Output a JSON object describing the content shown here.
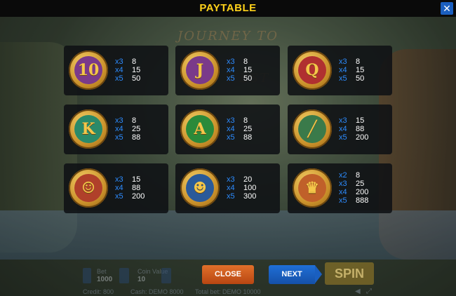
{
  "header": {
    "title": "PAYTABLE",
    "close_icon": "✕"
  },
  "background": {
    "logo_text": "JOURNEY TO THE WEST"
  },
  "symbols": [
    {
      "name": "10",
      "glyph": "10",
      "ring": "#7a3a8a",
      "pays": [
        {
          "m": "x3",
          "v": "8"
        },
        {
          "m": "x4",
          "v": "15"
        },
        {
          "m": "x5",
          "v": "50"
        }
      ]
    },
    {
      "name": "J",
      "glyph": "J",
      "ring": "#7a3a8a",
      "pays": [
        {
          "m": "x3",
          "v": "8"
        },
        {
          "m": "x4",
          "v": "15"
        },
        {
          "m": "x5",
          "v": "50"
        }
      ]
    },
    {
      "name": "Q",
      "glyph": "Q",
      "ring": "#b03030",
      "pays": [
        {
          "m": "x3",
          "v": "8"
        },
        {
          "m": "x4",
          "v": "15"
        },
        {
          "m": "x5",
          "v": "50"
        }
      ]
    },
    {
      "name": "K",
      "glyph": "K",
      "ring": "#2a8a6a",
      "pays": [
        {
          "m": "x3",
          "v": "8"
        },
        {
          "m": "x4",
          "v": "25"
        },
        {
          "m": "x5",
          "v": "88"
        }
      ]
    },
    {
      "name": "A",
      "glyph": "A",
      "ring": "#2a8a3a",
      "pays": [
        {
          "m": "x3",
          "v": "8"
        },
        {
          "m": "x4",
          "v": "25"
        },
        {
          "m": "x5",
          "v": "88"
        }
      ]
    },
    {
      "name": "staff",
      "glyph": "╱",
      "ring": "#3a7a4a",
      "pays": [
        {
          "m": "x3",
          "v": "15"
        },
        {
          "m": "x4",
          "v": "88"
        },
        {
          "m": "x5",
          "v": "200"
        }
      ]
    },
    {
      "name": "pigsy",
      "glyph": "☺",
      "ring": "#b0402a",
      "pays": [
        {
          "m": "x3",
          "v": "15"
        },
        {
          "m": "x4",
          "v": "88"
        },
        {
          "m": "x5",
          "v": "200"
        }
      ]
    },
    {
      "name": "sandy",
      "glyph": "☻",
      "ring": "#2a5a9a",
      "pays": [
        {
          "m": "x3",
          "v": "20"
        },
        {
          "m": "x4",
          "v": "100"
        },
        {
          "m": "x5",
          "v": "300"
        }
      ]
    },
    {
      "name": "monkey",
      "glyph": "♛",
      "ring": "#c0602a",
      "pays": [
        {
          "m": "x2",
          "v": "8"
        },
        {
          "m": "x3",
          "v": "25"
        },
        {
          "m": "x4",
          "v": "200"
        },
        {
          "m": "x5",
          "v": "888"
        }
      ]
    }
  ],
  "buttons": {
    "close_label": "CLOSE",
    "next_label": "NEXT",
    "spin_label": "SPIN"
  },
  "footer": {
    "bet_label": "Bet",
    "bet_value": "1000",
    "coin_label": "Coin Value",
    "coin_value": "10",
    "credit": "Credit: 800",
    "cash": "Cash: DEMO 8000",
    "total_bet": "Total bet: DEMO 10000"
  }
}
